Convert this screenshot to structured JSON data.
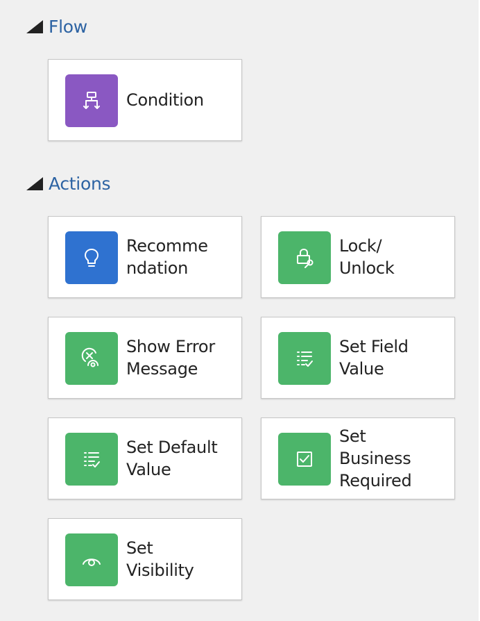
{
  "sections": {
    "flow": {
      "title": "Flow",
      "items": [
        {
          "label": "Condition",
          "icon": "condition-icon",
          "color": "#8a58c2"
        }
      ]
    },
    "actions": {
      "title": "Actions",
      "items": [
        {
          "label": "Recomme\nndation",
          "icon": "lightbulb-icon",
          "color": "#2f72d0"
        },
        {
          "label": "Lock/\nUnlock",
          "icon": "lock-unlock-icon",
          "color": "#4cb56a"
        },
        {
          "label": "Show Error\nMessage",
          "icon": "error-message-icon",
          "color": "#4cb56a"
        },
        {
          "label": "Set Field\nValue",
          "icon": "field-list-icon",
          "color": "#4cb56a"
        },
        {
          "label": "Set Default\nValue",
          "icon": "default-list-icon",
          "color": "#4cb56a"
        },
        {
          "label": "Set\nBusiness\nRequired",
          "icon": "checkbox-icon",
          "color": "#4cb56a"
        },
        {
          "label": "Set\nVisibility",
          "icon": "eye-icon",
          "color": "#4cb56a"
        }
      ]
    }
  }
}
